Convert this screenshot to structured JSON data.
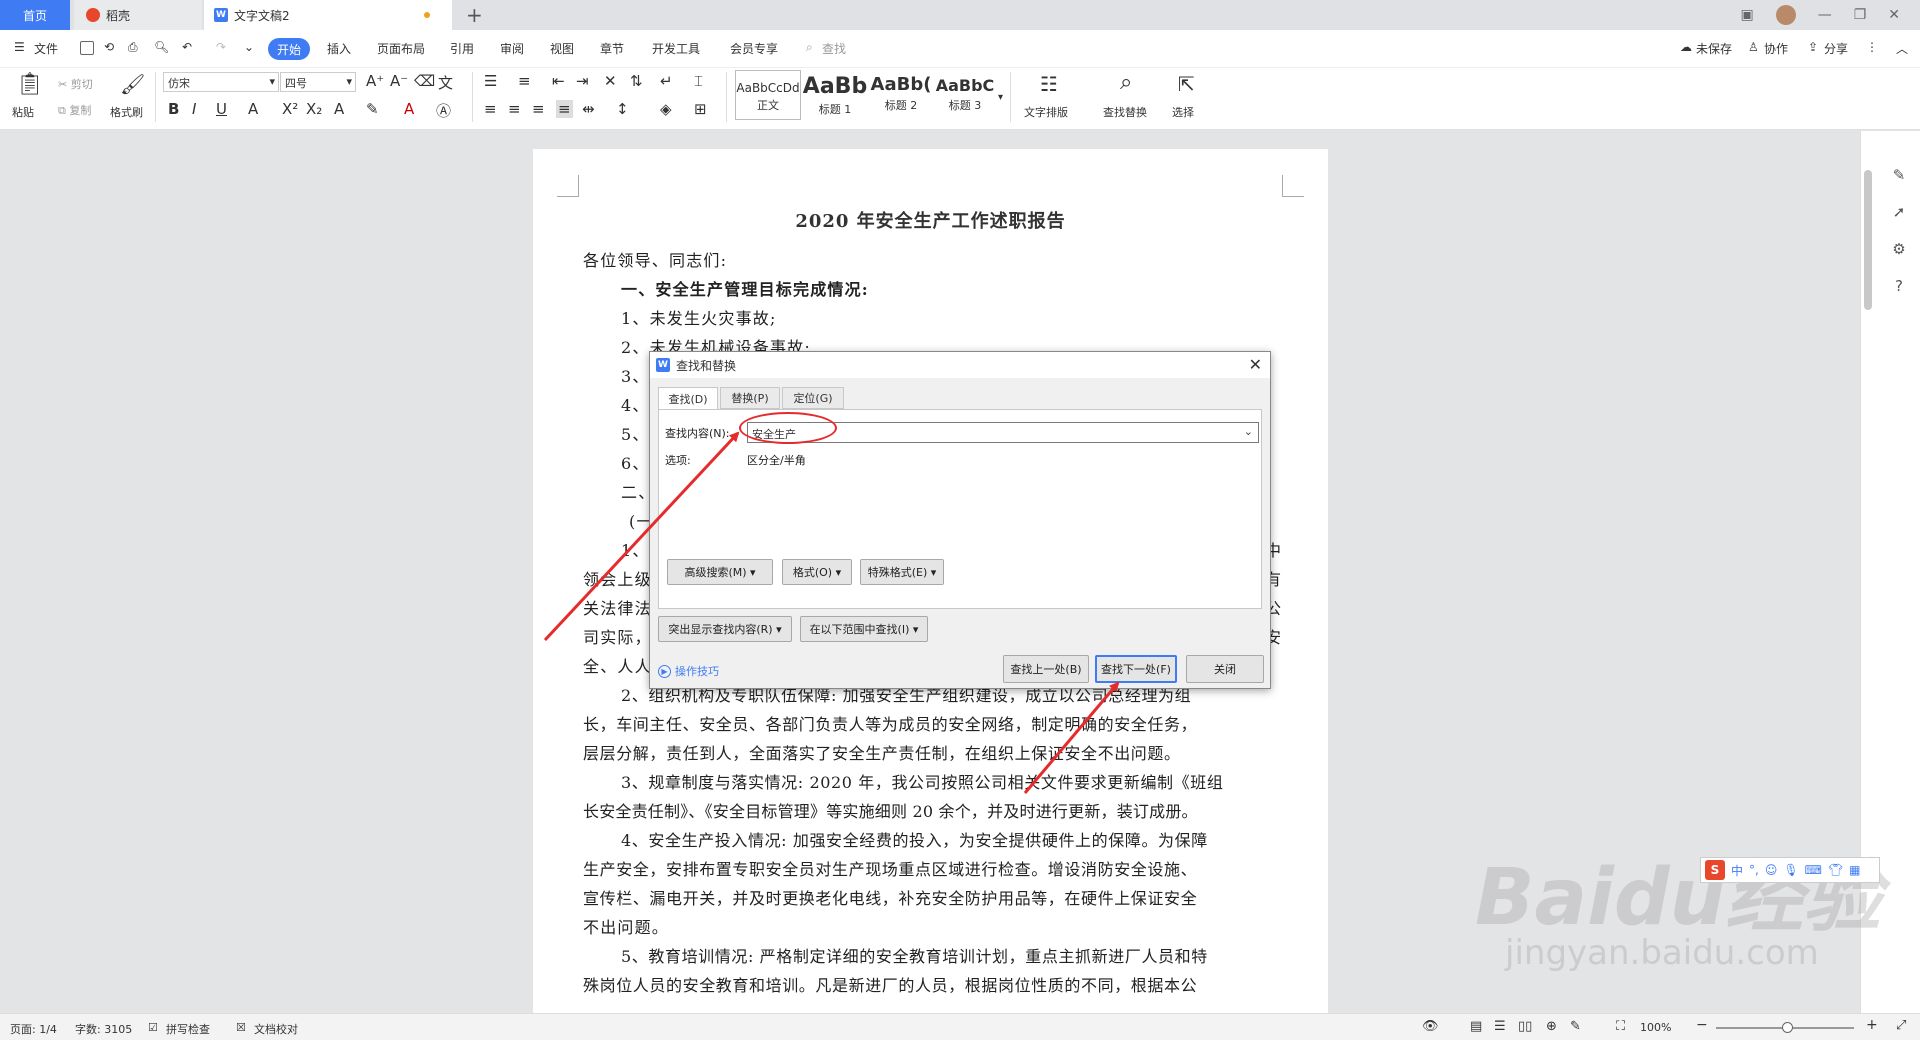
{
  "tabs": {
    "home": "首页",
    "wps": "稻壳",
    "doc": "文字文稿2"
  },
  "menu": {
    "file": "文件",
    "start": "开始",
    "items": [
      "插入",
      "页面布局",
      "引用",
      "审阅",
      "视图",
      "章节",
      "开发工具",
      "会员专享"
    ],
    "search": "查找",
    "unsaved": "未保存",
    "collab": "协作",
    "share": "分享"
  },
  "ribbon": {
    "paste": "粘贴",
    "cut": "剪切",
    "copy": "复制",
    "format_painter": "格式刷",
    "font": "仿宋",
    "size": "四号",
    "styles": [
      {
        "preview": "AaBbCcDd",
        "label": "正文"
      },
      {
        "preview": "AaBb",
        "label": "标题 1"
      },
      {
        "preview": "AaBb(",
        "label": "标题 2"
      },
      {
        "preview": "AaBbC",
        "label": "标题 3"
      }
    ],
    "text_layout": "文字排版",
    "find_replace": "查找替换",
    "select": "选择"
  },
  "document": {
    "title": "2020 年安全生产工作述职报告",
    "lines": [
      "各位领导、同志们:",
      "一、安全生产管理目标完成情况:",
      "1、未发生火灾事故;",
      "2、未发生机械设备事故;",
      "3、",
      "4、",
      "5、",
      "6、",
      "二、",
      "(一",
      "1、",
      "领会上级",
      "关法律法",
      "司实际，",
      "全、人人",
      "2、组织机构及专职队伍保障: 加强安全生产组织建设，成立以公司总经理为组",
      "长，车间主任、安全员、各部门负责人等为成员的安全网络，制定明确的安全任务，",
      "层层分解，责任到人，全面落实了安全生产责任制，在组织上保证安全不出问题。",
      "3、规章制度与落实情况: 2020 年，我公司按照公司相关文件要求更新编制《班组",
      "长安全责任制》、《安全目标管理》等实施细则 20 余个，并及时进行更新，装订成册。",
      "4、安全生产投入情况: 加强安全经费的投入，为安全提供硬件上的保障。为保障",
      "生产安全，安排布置专职安全员对生产现场重点区域进行检查。增设消防安全设施、",
      "宣传栏、漏电开关，并及时更换老化电线，补充安全防护用品等，在硬件上保证安全",
      "不出问题。",
      "5、教育培训情况: 严格制定详细的安全教育培训计划，重点主抓新进厂人员和特",
      "殊岗位人员的安全教育和培训。凡是新进厂的人员，根据岗位性质的不同，根据本公"
    ],
    "right_edge_chars": [
      "中",
      "有",
      "公",
      "安"
    ]
  },
  "dialog": {
    "title": "查找和替换",
    "tab_find": "查找(D)",
    "tab_replace": "替换(P)",
    "tab_goto": "定位(G)",
    "find_label": "查找内容(N):",
    "find_value": "安全生产",
    "options_label": "选项:",
    "options_value": "区分全/半角",
    "advanced": "高级搜索(M) ▾",
    "format": "格式(O) ▾",
    "special": "特殊格式(E) ▾",
    "highlight": "突出显示查找内容(R) ▾",
    "in_range": "在以下范围中查找(I) ▾",
    "tips": "操作技巧",
    "find_prev": "查找上一处(B)",
    "find_next": "查找下一处(F)",
    "close": "关闭"
  },
  "status": {
    "page": "页面: 1/4",
    "words": "字数: 3105",
    "spell": "拼写检查",
    "proof": "文档校对",
    "zoom": "100%"
  },
  "ime": {
    "lang": "中"
  },
  "watermark": {
    "brand": "Baidu经验",
    "url": "jingyan.baidu.com"
  }
}
